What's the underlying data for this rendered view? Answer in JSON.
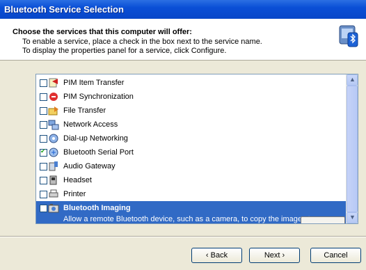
{
  "window": {
    "title": "Bluetooth Service Selection"
  },
  "header": {
    "heading": "Choose the services that this computer will offer:",
    "line1": "To enable a service, place a check in the box next to the service name.",
    "line2": "To display the properties panel for a service, click Configure."
  },
  "services": [
    {
      "label": "PIM Item Transfer",
      "checked": false,
      "icon": "pim-item-transfer-icon"
    },
    {
      "label": "PIM Synchronization",
      "checked": false,
      "icon": "pim-sync-icon"
    },
    {
      "label": "File Transfer",
      "checked": false,
      "icon": "file-transfer-icon"
    },
    {
      "label": "Network Access",
      "checked": false,
      "icon": "network-access-icon"
    },
    {
      "label": "Dial-up Networking",
      "checked": false,
      "icon": "dialup-icon"
    },
    {
      "label": "Bluetooth Serial Port",
      "checked": true,
      "icon": "serial-port-icon"
    },
    {
      "label": "Audio Gateway",
      "checked": false,
      "icon": "audio-gateway-icon"
    },
    {
      "label": "Headset",
      "checked": false,
      "icon": "headset-icon"
    },
    {
      "label": "Printer",
      "checked": false,
      "icon": "printer-icon"
    }
  ],
  "selected_service": {
    "label": "Bluetooth Imaging",
    "checked": false,
    "description": "Allow a remote Bluetooth device, such as a camera, to copy the images to"
  },
  "buttons": {
    "back": "Back",
    "next": "Next",
    "cancel": "Cancel"
  },
  "colors": {
    "titlebar": "#0a4fd6",
    "selection": "#316ac5",
    "face": "#ece9d8"
  }
}
